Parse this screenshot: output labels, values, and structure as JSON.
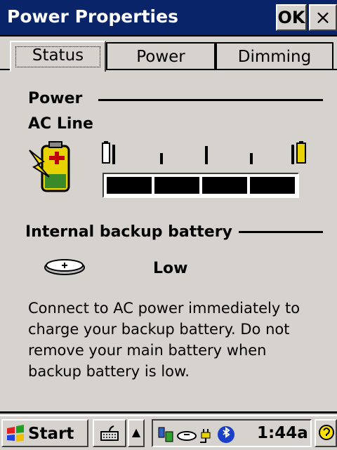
{
  "window": {
    "title": "Power Properties",
    "ok_label": "OK",
    "close_label": "×"
  },
  "tabs": [
    {
      "label": "Status",
      "active": true
    },
    {
      "label": "Power",
      "active": false
    },
    {
      "label": "Dimming",
      "active": false
    }
  ],
  "power": {
    "heading": "Power",
    "source": "AC Line",
    "level_segments_filled": 4,
    "level_segments_total": 4
  },
  "backup": {
    "heading": "Internal backup battery",
    "status": "Low",
    "message": "Connect to AC power immediately to charge your backup battery. Do not remove your main battery when backup battery is low."
  },
  "taskbar": {
    "start_label": "Start",
    "time": "1:44a",
    "up_arrow": "▲",
    "icons": [
      "windows-flag-icon",
      "keyboard-icon",
      "network-icon",
      "backup-battery-icon",
      "ac-plug-icon",
      "bluetooth-icon",
      "help-icon"
    ]
  },
  "colors": {
    "titlebar": "#0a246a",
    "face": "#d6d3ce",
    "bluetooth": "#1a3fc8"
  }
}
